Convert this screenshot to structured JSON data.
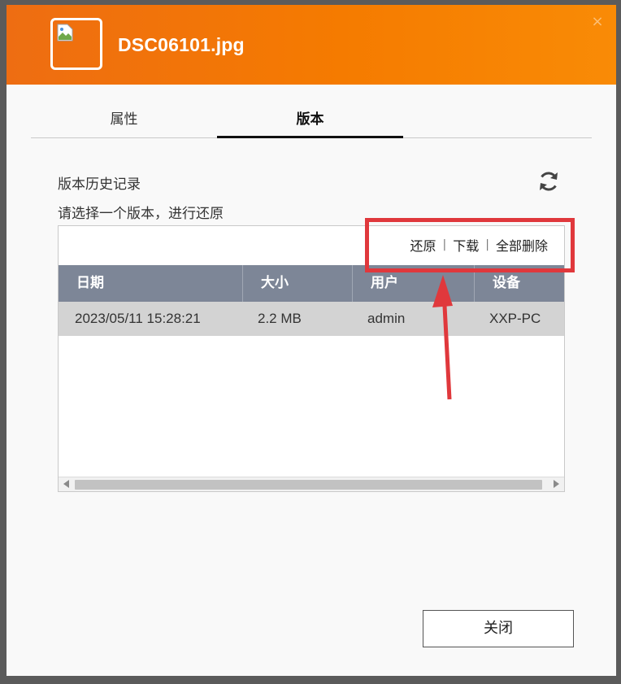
{
  "header": {
    "file_name": "DSC06101.jpg",
    "close_glyph": "×"
  },
  "tabs": [
    {
      "label": "属性",
      "active": false
    },
    {
      "label": "版本",
      "active": true
    }
  ],
  "version_section": {
    "title": "版本历史记录",
    "description": "请选择一个版本，进行还原",
    "actions": {
      "restore": "还原",
      "download": "下载",
      "delete_all": "全部删除",
      "separator": "|"
    }
  },
  "table": {
    "columns": [
      "日期",
      "大小",
      "用户",
      "设备"
    ],
    "rows": [
      {
        "date": "2023/05/11 15:28:21",
        "size": "2.2 MB",
        "user": "admin",
        "device": "XXP-PC"
      }
    ]
  },
  "footer": {
    "close_label": "关闭"
  },
  "colors": {
    "header_orange": "#f57b00",
    "table_header": "#7d8697",
    "highlight_red": "#e0383c"
  },
  "icons": {
    "refresh": "refresh-icon",
    "thumbnail": "broken-image-icon"
  }
}
